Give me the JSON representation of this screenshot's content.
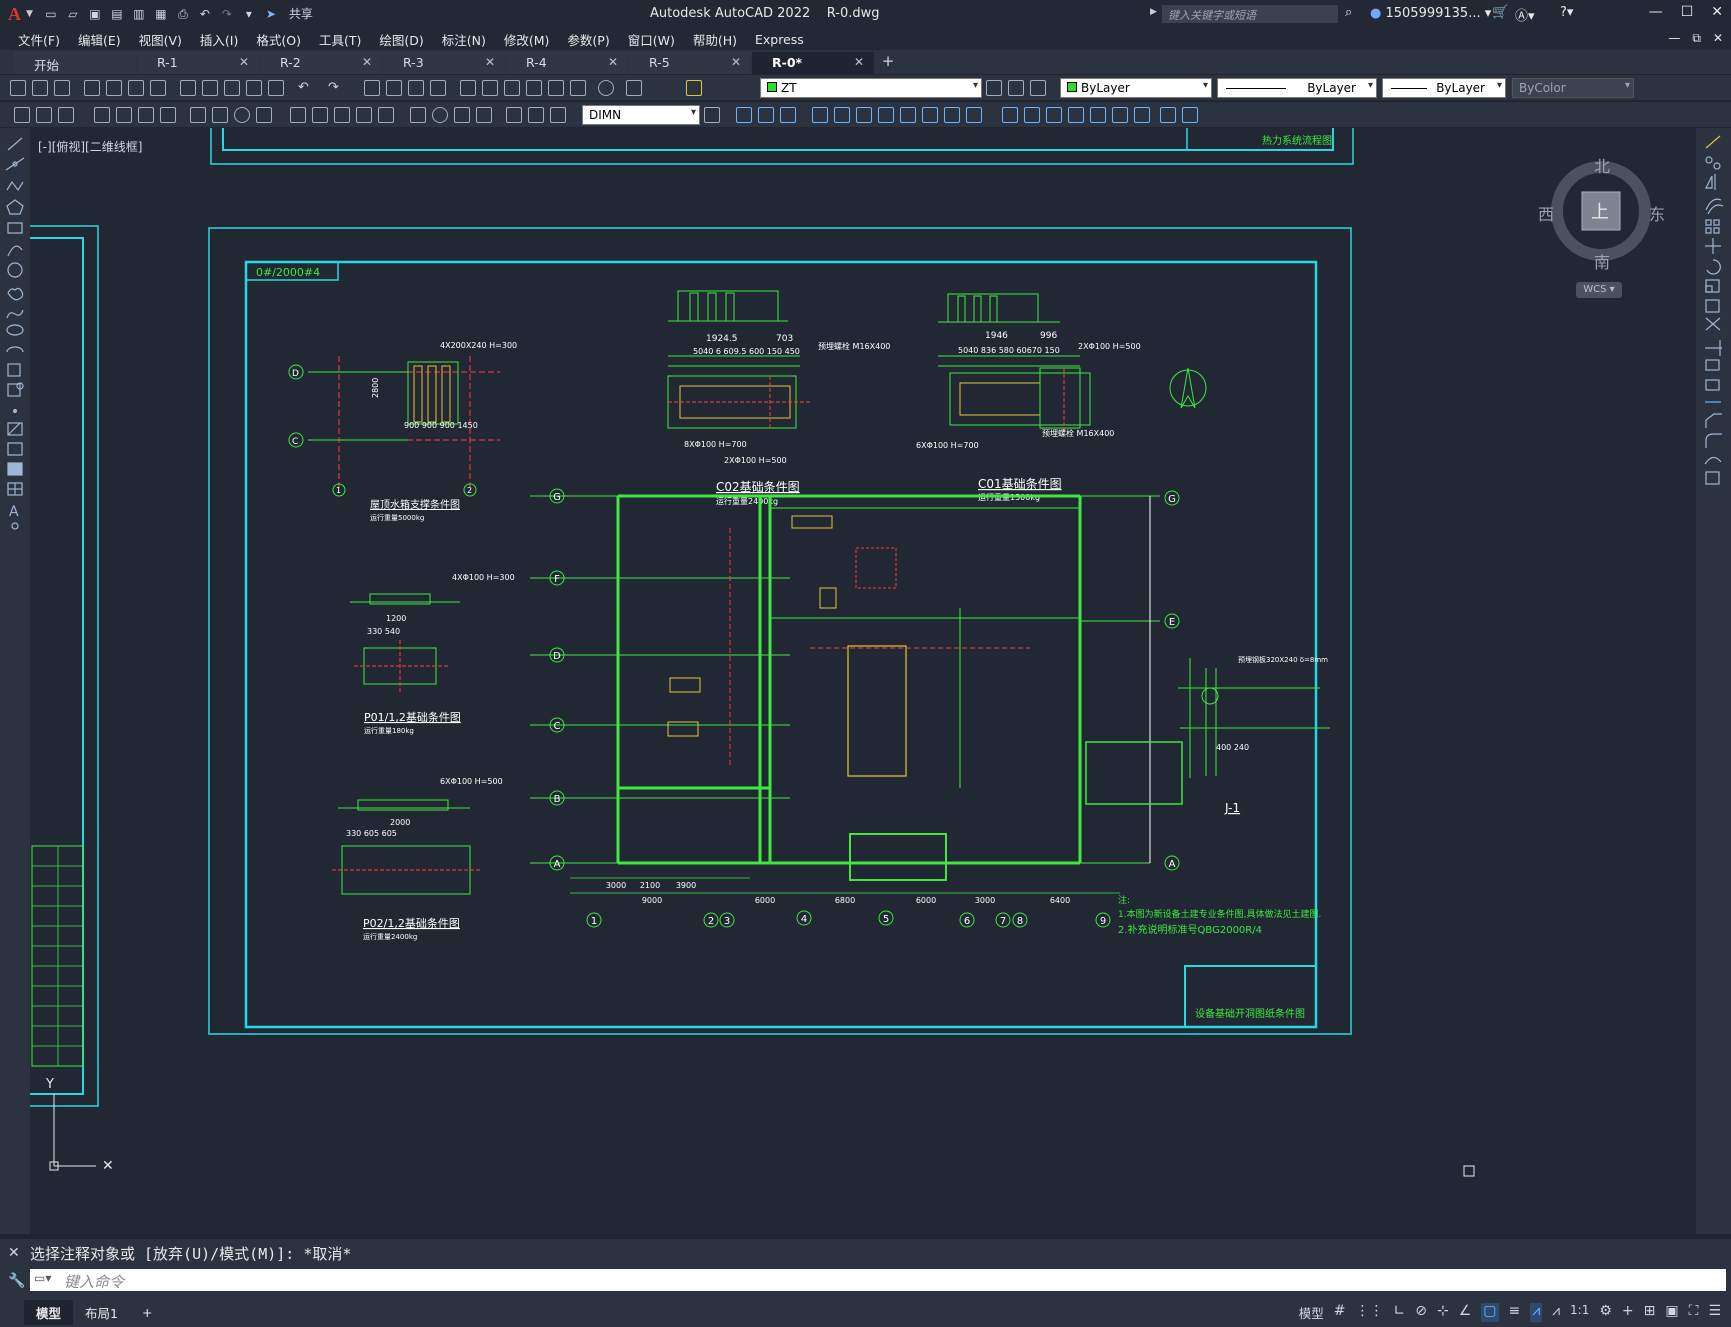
{
  "titlebar": {
    "share_label": "共享",
    "app_title": "Autodesk AutoCAD 2022",
    "doc_name": "R-0.dwg",
    "search_placeholder": "键入关键字或短语",
    "user_name": "1505999135...",
    "window_buttons": [
      "minimize",
      "restore",
      "close"
    ]
  },
  "menu": [
    "文件(F)",
    "编辑(E)",
    "视图(V)",
    "插入(I)",
    "格式(O)",
    "工具(T)",
    "绘图(D)",
    "标注(N)",
    "修改(M)",
    "参数(P)",
    "窗口(W)",
    "帮助(H)",
    "Express"
  ],
  "tabs": [
    {
      "label": "开始"
    },
    {
      "label": "R-1"
    },
    {
      "label": "R-2"
    },
    {
      "label": "R-3"
    },
    {
      "label": "R-4"
    },
    {
      "label": "R-5"
    },
    {
      "label": "R-0*",
      "active": true
    }
  ],
  "toolbar": {
    "layer_value": "ZT",
    "color_value": "ByLayer",
    "linetype_value": "ByLayer",
    "lineweight_value": "ByLayer",
    "plotstyle_value": "ByColor",
    "dimstyle_value": "DIMN"
  },
  "viewport": {
    "label": "[-][俯视][二维线框]",
    "compass": {
      "north": "北",
      "south": "南",
      "east": "东",
      "west": "西",
      "center": "上",
      "ucs": "WCS"
    }
  },
  "drawing": {
    "top_title": "热力系统流程图",
    "bottom_title": "设备基础开洞图纸条件图",
    "tag": "0#/2000#4",
    "c02_title": "C02基础条件图",
    "c02_sub": "运行重量2400kg",
    "c01_title": "C01基础条件图",
    "c01_sub": "运行重量1500kg",
    "roof_title": "屋顶水箱支撑条件图",
    "roof_sub": "运行重量5000kg",
    "p01_title": "P01/1,2基础条件图",
    "p01_sub": "运行重量180kg",
    "p02_title": "P02/1,2基础条件图",
    "p02_sub": "运行重量2400kg",
    "j1_title": "J-1",
    "notes": [
      "注:",
      "1.本图为新设备土建专业条件图,具体做法见土建图.",
      "2.补充说明标准号QBG2000R/4"
    ],
    "grid_cols": [
      "1",
      "2",
      "3",
      "4",
      "5",
      "6",
      "7",
      "8",
      "9"
    ],
    "grid_rows": [
      "G",
      "F",
      "E",
      "D",
      "C",
      "B",
      "A"
    ],
    "dims_bottom": [
      "3000",
      "2100",
      "3900",
      "9000",
      "6000",
      "6800",
      "6000",
      "3000",
      "6400"
    ]
  },
  "command": {
    "history": "选择注释对象或 [放弃(U)/模式(M)]: *取消*",
    "placeholder": "键入命令"
  },
  "status": {
    "tabs": [
      "模型",
      "布局1"
    ],
    "add": "+",
    "model_label": "模型",
    "scale": "1:1"
  }
}
